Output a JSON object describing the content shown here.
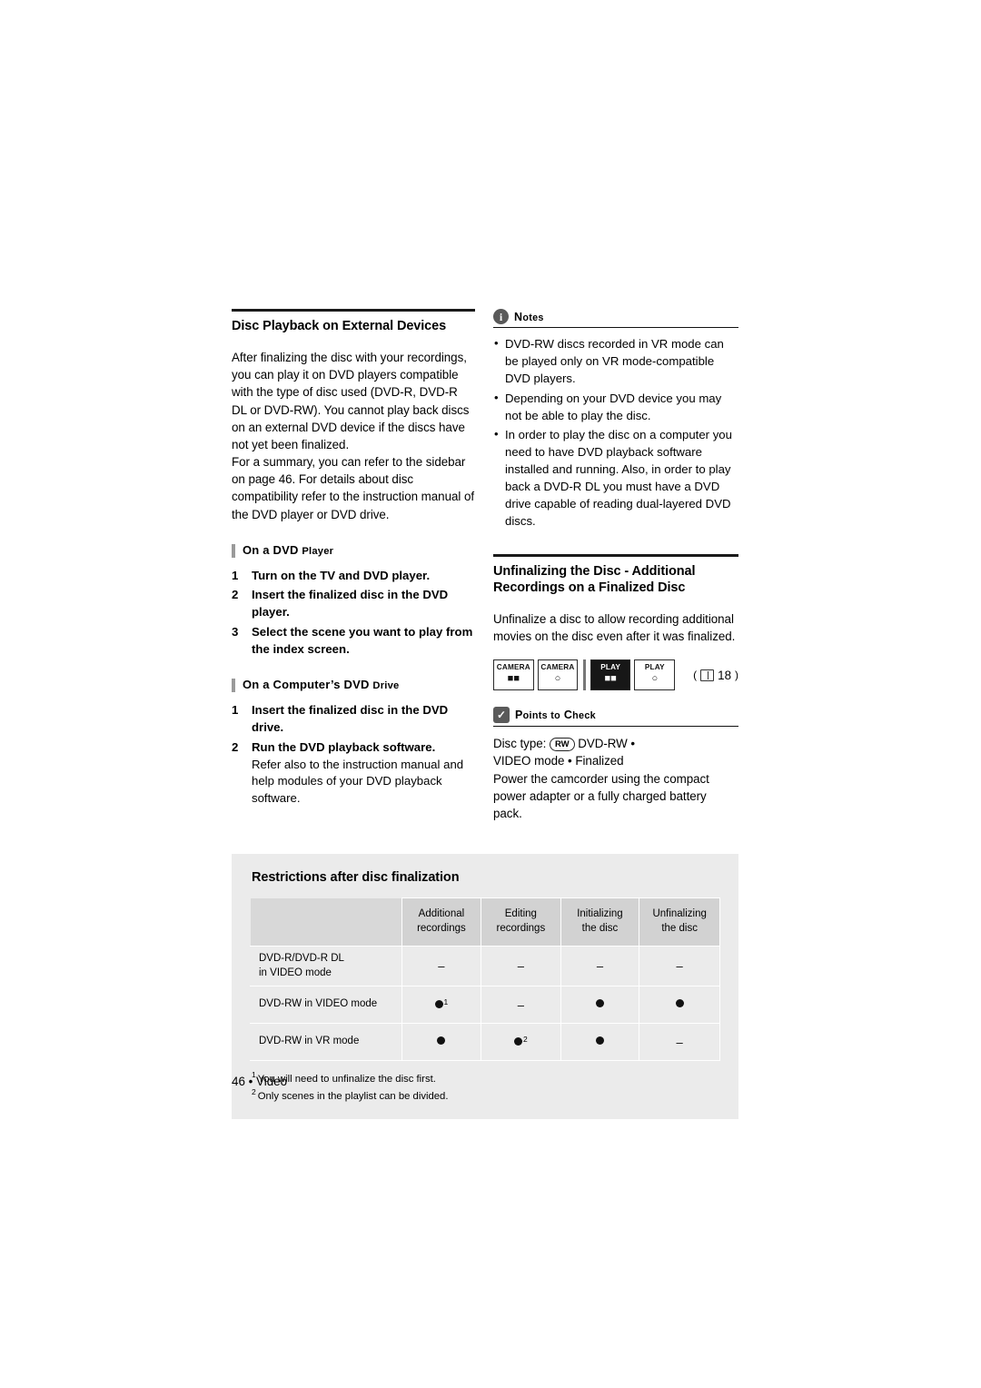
{
  "left": {
    "title": "Disc Playback on External Devices",
    "paragraphs": [
      "After finalizing the disc with your recordings, you can play it on DVD players compatible with the type of disc used (DVD-R, DVD-R DL or DVD-RW). You cannot play back discs on an external DVD device if the discs have not yet been finalized.",
      "For a summary, you can refer to the sidebar on page 46. For details about disc compatibility refer to the instruction manual of the DVD player or DVD drive."
    ],
    "subhead_player_pre": "On a DVD",
    "subhead_player_sc": "Player",
    "player_steps": [
      {
        "num": "1",
        "text": "Turn on the TV and DVD player."
      },
      {
        "num": "2",
        "text": "Insert the finalized disc in the DVD player."
      },
      {
        "num": "3",
        "text": "Select the scene you want to play from the index screen."
      }
    ],
    "subhead_drive_pre": "On a Computer’s DVD",
    "subhead_drive_sc": "Drive",
    "drive_steps": [
      {
        "num": "1",
        "text": "Insert the finalized disc in the DVD drive."
      },
      {
        "num": "2",
        "text": "Run the DVD playback software.",
        "plain": "Refer also to the instruction manual and help modules of your DVD playback software."
      }
    ]
  },
  "right": {
    "notes_label_pre": "N",
    "notes_label_sc": "otes",
    "notes_icon": "info-icon",
    "notes": [
      "DVD-RW discs recorded in VR mode can be played only on VR mode-compatible DVD players.",
      "Depending on your DVD device you may not be able to play the disc.",
      "In order to play the disc on a computer you need to have DVD playback software installed and running. Also, in order to play back a DVD-R DL you must have a DVD drive capable of reading dual-layered DVD discs."
    ],
    "section2_title_line1": "Unfinalizing the Disc - Additional",
    "section2_title_line2": "Recordings on a Finalized Disc",
    "section2_paragraph": "Unfinalize a disc to allow recording additional movies on the disc even after it was finalized.",
    "modes": [
      {
        "top": "CAMERA",
        "icon": "·■■",
        "active": false,
        "name": "camera-movie-mode"
      },
      {
        "top": "CAMERA",
        "icon": "◯",
        "active": false,
        "name": "camera-photo-mode"
      },
      {
        "top": "PLAY",
        "icon": "·■■",
        "active": true,
        "name": "play-movie-mode"
      },
      {
        "top": "PLAY",
        "icon": "◯",
        "active": false,
        "name": "play-photo-mode"
      }
    ],
    "page_ref": "18",
    "points_label_pre": "P",
    "points_label_sc": "oints to",
    "points_label_pre2": "C",
    "points_label_sc2": "heck",
    "points_icon": "check-badge-icon",
    "disc_type_label": "Disc type:",
    "disc_type_chip": "RW",
    "disc_type_value": "DVD-RW •",
    "disc_mode_line": "VIDEO mode • Finalized",
    "points_paragraph": "Power the camcorder using the compact power adapter or a fully charged battery pack."
  },
  "panel": {
    "title": "Restrictions after disc finalization",
    "columns": [
      {
        "line1": "Additional",
        "line2": "recordings"
      },
      {
        "line1": "Editing",
        "line2": "recordings"
      },
      {
        "line1": "Initializing",
        "line2": "the disc"
      },
      {
        "line1": "Unfinalizing",
        "line2": "the disc"
      }
    ],
    "rows": [
      {
        "label_line1": "DVD-R/DVD-R DL",
        "label_line2": "in VIDEO mode",
        "cells": [
          {
            "type": "dash",
            "value": "–"
          },
          {
            "type": "dash",
            "value": "–"
          },
          {
            "type": "dash",
            "value": "–"
          },
          {
            "type": "dash",
            "value": "–"
          }
        ]
      },
      {
        "label_line1": "DVD-RW in VIDEO mode",
        "label_line2": "",
        "cells": [
          {
            "type": "dot",
            "sup": "1"
          },
          {
            "type": "dash",
            "value": "–"
          },
          {
            "type": "dot",
            "sup": ""
          },
          {
            "type": "dot",
            "sup": ""
          }
        ]
      },
      {
        "label_line1": "DVD-RW in VR mode",
        "label_line2": "",
        "cells": [
          {
            "type": "dot",
            "sup": ""
          },
          {
            "type": "dot",
            "sup": "2"
          },
          {
            "type": "dot",
            "sup": ""
          },
          {
            "type": "dash",
            "value": "–"
          }
        ]
      }
    ],
    "footnotes": [
      {
        "num": "1",
        "text": "You will need to unfinalize the disc first."
      },
      {
        "num": "2",
        "text": "Only scenes in the playlist can be divided."
      }
    ]
  },
  "folio": "46 • Video"
}
